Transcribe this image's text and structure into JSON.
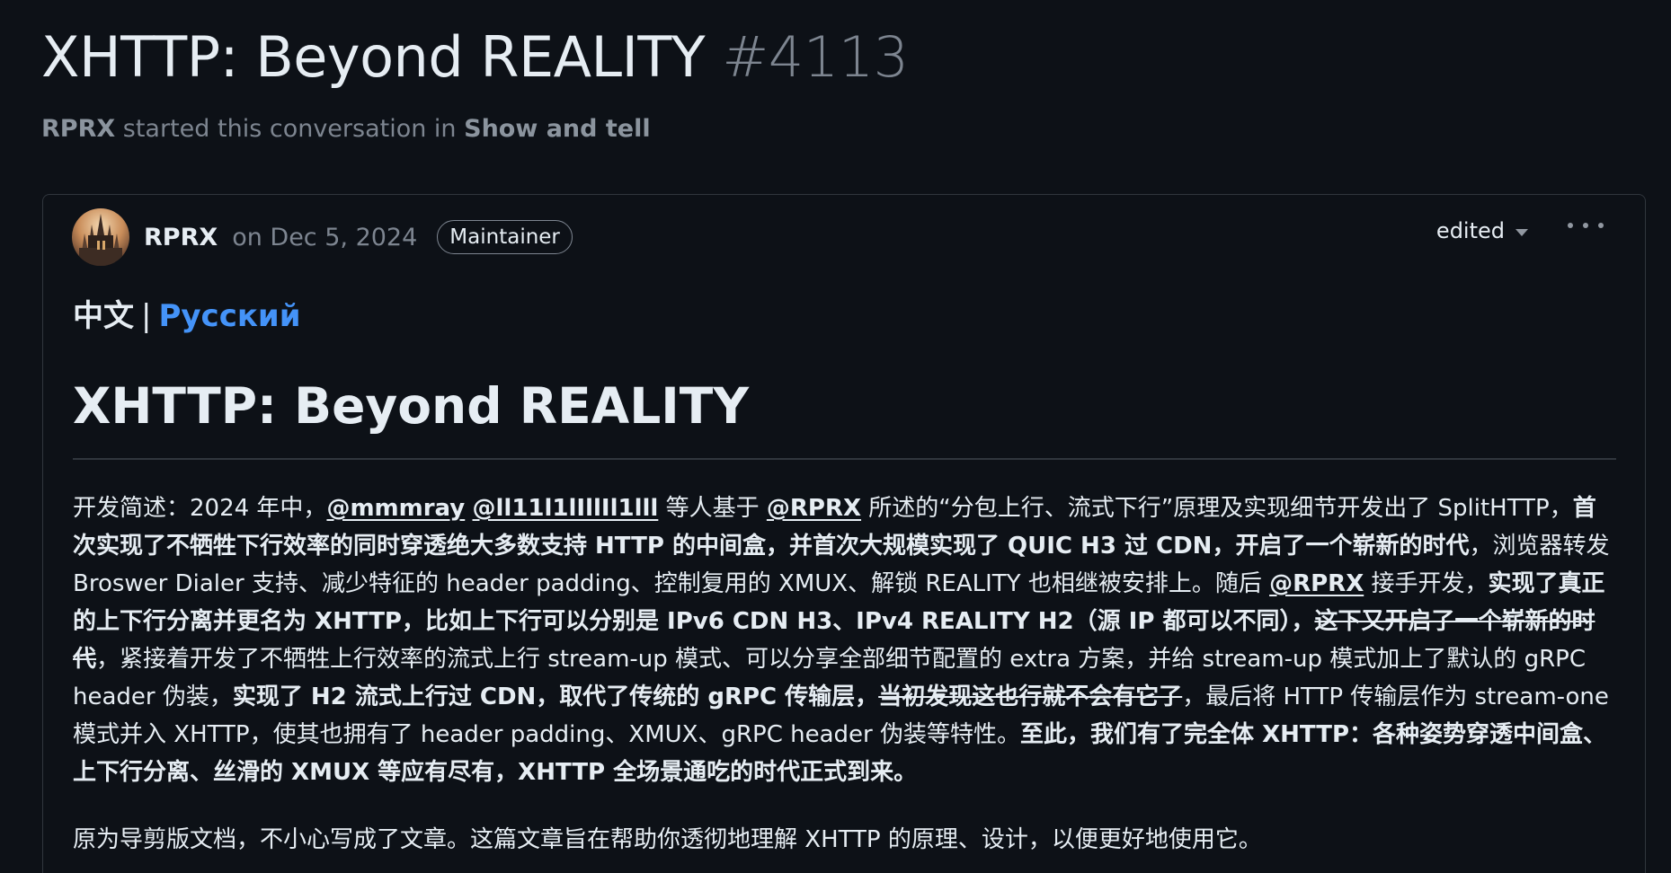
{
  "discussion": {
    "title": "XHTTP: Beyond REALITY",
    "number": "#4113",
    "started_by": "RPRX",
    "started_text": "started this conversation in",
    "category": "Show and tell"
  },
  "post": {
    "author": "RPRX",
    "date": "on Dec 5, 2024",
    "role_badge": "Maintainer",
    "edited_label": "edited",
    "lang_current": "中文",
    "lang_separator": "|",
    "lang_alt": "Русский",
    "heading": "XHTTP: Beyond REALITY",
    "p1": {
      "s1": "开发简述：2024 年中，",
      "m1": "@mmmray",
      "s2": " ",
      "m2": "@ll11l1lIllIl1lll",
      "s3": " 等人基于 ",
      "m3": "@RPRX",
      "s4": " 所述的“分包上行、流式下行”原理及实现细节开发出了 SplitHTTP，",
      "b1": "首次实现了不牺牲下行效率的同时穿透绝大多数支持 HTTP 的中间盒，并首次大规模实现了 QUIC H3 过 CDN，开启了一个崭新的时代",
      "s5": "，浏览器转发 Broswer Dialer 支持、减少特征的 header padding、控制复用的 XMUX、解锁 REALITY 也相继被安排上。随后 ",
      "m4": "@RPRX",
      "s6": " 接手开发，",
      "b2": "实现了真正的上下行分离并更名为 XHTTP，比如上下行可以分别是 IPv6 CDN H3、IPv4 REALITY H2（源 IP 都可以不同），",
      "st1": "这下又开启了一个崭新的时代",
      "s7": "，紧接着开发了不牺牲上行效率的流式上行 stream-up 模式、可以分享全部细节配置的 extra 方案，并给 stream-up 模式加上了默认的 gRPC header 伪装，",
      "b3": "实现了 H2 流式上行过 CDN，取代了传统的 gRPC 传输层，",
      "st2": "当初发现这也行就不会有它了",
      "s8": "，最后将 HTTP 传输层作为 stream-one 模式并入 XHTTP，使其也拥有了 header padding、XMUX、gRPC header 伪装等特性。",
      "b4": "至此，我们有了完全体 XHTTP：各种姿势穿透中间盒、上下行分离、丝滑的 XMUX 等应有尽有，XHTTP 全场景通吃的时代正式到来。"
    },
    "p2": "原为导剪版文档，不小心写成了文章。这篇文章旨在帮助你透彻地理解 XHTTP 的原理、设计，以便更好地使用它。"
  },
  "colors": {
    "background": "#0d1117",
    "border": "#30363d",
    "muted": "#7d8590",
    "link": "#4493f8",
    "text": "#e6edf3"
  },
  "icons": {
    "edited_caret": "triangle-down-icon",
    "more": "kebab-horizontal-icon"
  }
}
